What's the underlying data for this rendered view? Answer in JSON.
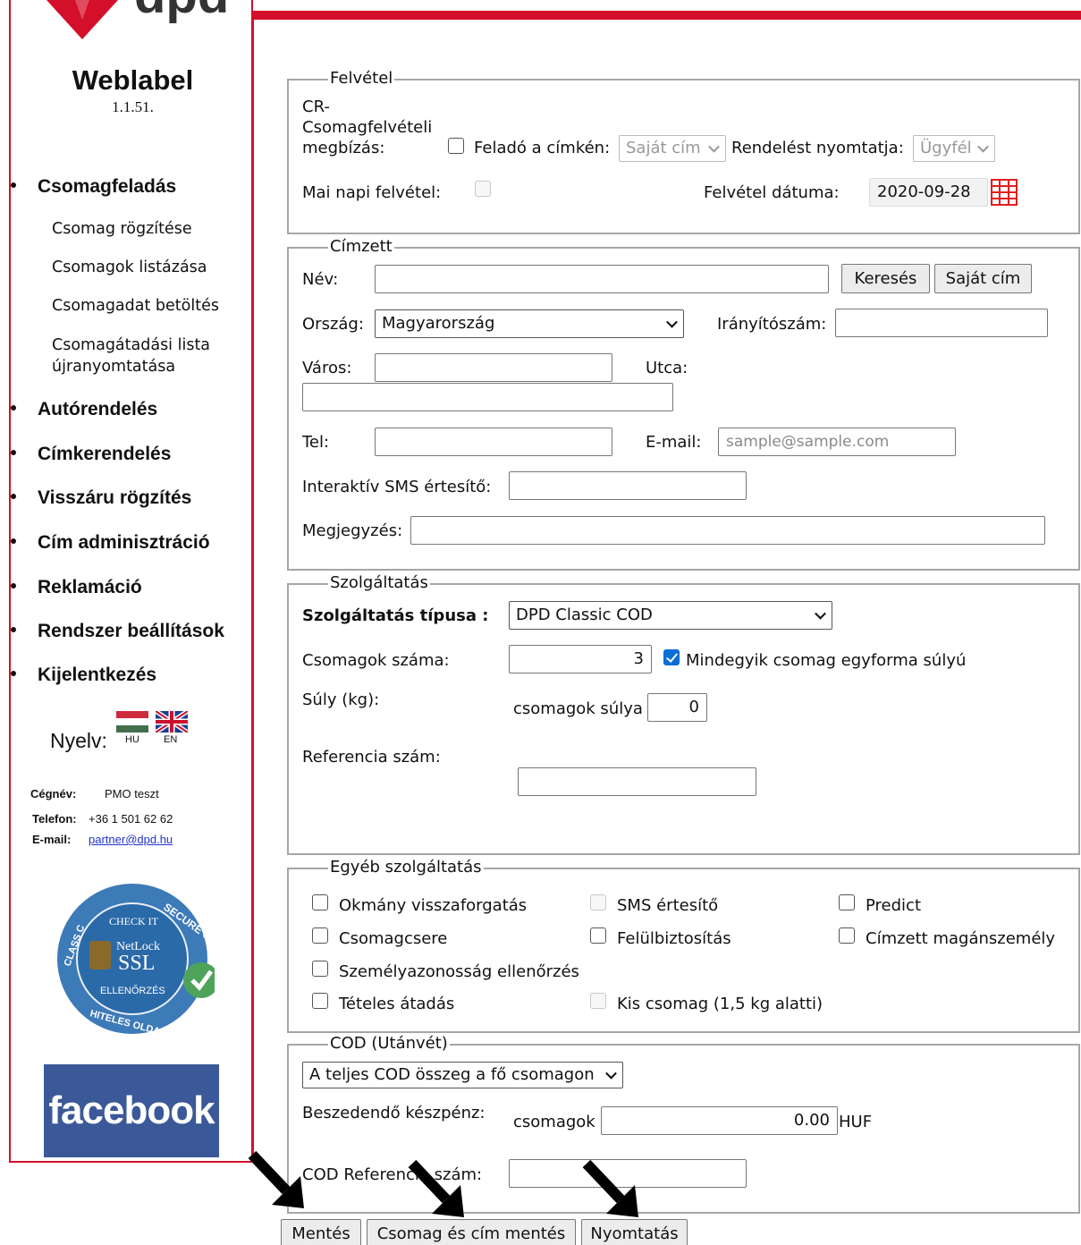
{
  "brand": {
    "app_name": "Weblabel",
    "version": "1.1.51.",
    "logo_text": "dpd",
    "accent": "#d40f2a"
  },
  "sidebar": {
    "menu": [
      {
        "label": "Csomagfeladás",
        "sub": [
          "Csomag rögzítése",
          "Csomagok listázása",
          "Csomagadat betöltés",
          "Csomagátadási lista újranyomtatása"
        ]
      },
      {
        "label": "Autórendelés"
      },
      {
        "label": "Címkerendelés"
      },
      {
        "label": "Visszáru rögzítés"
      },
      {
        "label": "Cím adminisztráció"
      },
      {
        "label": "Reklamáció"
      },
      {
        "label": "Rendszer beállítások"
      },
      {
        "label": "Kijelentkezés"
      }
    ],
    "language": {
      "label": "Nyelv:",
      "hu": "HU",
      "en": "EN"
    },
    "company": {
      "name_label": "Cégnév:",
      "name": "PMO teszt",
      "phone_label": "Telefon:",
      "phone": "+36 1 501 62 62",
      "email_label": "E-mail:",
      "email": "partner@dpd.hu"
    },
    "badge": {
      "secure": "SECURE SITE",
      "check": "CHECK IT",
      "class": "CLASS C",
      "netlock": "NetLock",
      "ssl": "SSL",
      "ellenorzes": "ELLENŐRZÉS",
      "hiteles": "HITELES OLDAL"
    },
    "facebook": "facebook"
  },
  "felvetel": {
    "legend": "Felvétel",
    "cr_label": "CR-\nCsomagfelvételi\nmegbízás:",
    "felado_label": "Feladó a címkén:",
    "felado_value": "Saját cím",
    "rendeles_label": "Rendelést nyomtatja:",
    "rendeles_value": "Ügyfél",
    "mai_label": "Mai napi felvétel:",
    "datum_label": "Felvétel dátuma:",
    "datum_value": "2020-09-28"
  },
  "cimzett": {
    "legend": "Címzett",
    "nev_label": "Név:",
    "kereses": "Keresés",
    "sajat_cim": "Saját cím",
    "orszag_label": "Ország:",
    "orszag_value": "Magyarország",
    "irsz_label": "Irányítószám:",
    "varos_label": "Város:",
    "utca_label": "Utca:",
    "tel_label": "Tel:",
    "email_label": "E-mail:",
    "email_placeholder": "sample@sample.com",
    "sms_label": "Interaktív SMS értesítő:",
    "megj_label": "Megjegyzés:"
  },
  "szolg": {
    "legend": "Szolgáltatás",
    "tipus_label": "Szolgáltatás típusa :",
    "tipus_value": "DPD Classic COD",
    "db_label": "Csomagok száma:",
    "db_value": "3",
    "egyforma_label": "Mindegyik csomag egyforma súlyú",
    "suly_label": "Súly (kg):",
    "csomagok_sulya": "csomagok súlya",
    "suly_value": "0",
    "ref_label": "Referencia szám:"
  },
  "egyeb": {
    "legend": "Egyéb szolgáltatás",
    "items": [
      "Okmány visszaforgatás",
      "SMS értesítő",
      "Predict",
      "Csomagcsere",
      "Felülbiztosítás",
      "Címzett magánszemély",
      "Személyazonosság ellenőrzés",
      "Tételes átadás",
      "Kis csomag (1,5 kg alatti)"
    ]
  },
  "cod": {
    "legend": "COD (Utánvét)",
    "mode_value": "A teljes COD összeg a fő csomagon",
    "beszed_label": "Beszedendő készpénz:",
    "csomagok": "csomagok",
    "amount": "0.00",
    "currency": "HUF",
    "ref_label": "COD Referencia szám:"
  },
  "actions": {
    "mentes": "Mentés",
    "csomag_cim_mentes": "Csomag és cím mentés",
    "nyomtatas": "Nyomtatás"
  }
}
